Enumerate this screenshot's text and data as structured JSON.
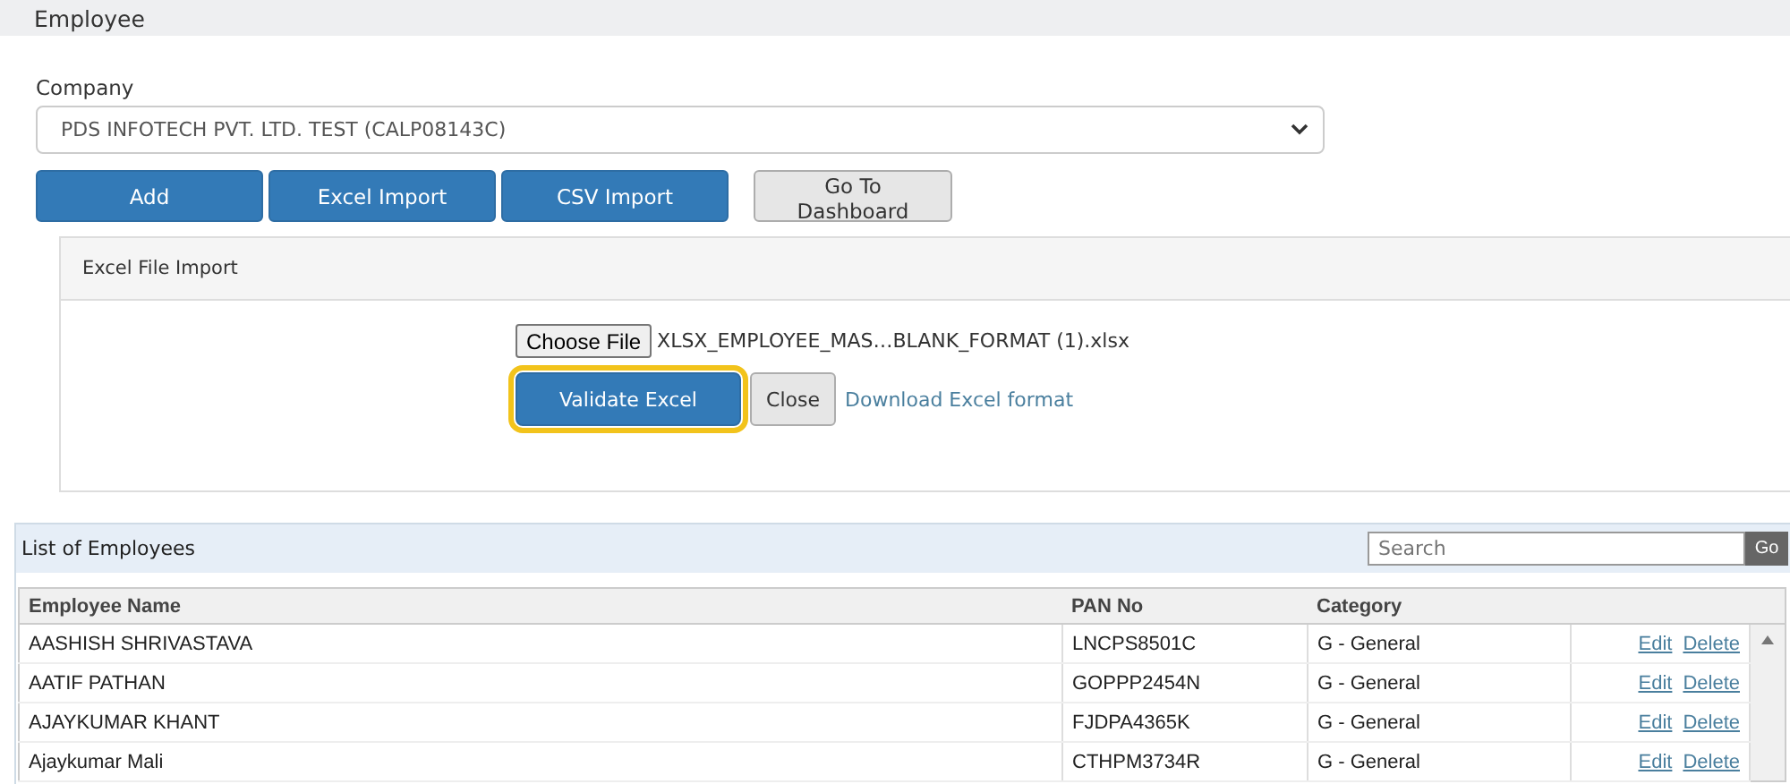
{
  "header": {
    "title": "Employee"
  },
  "company": {
    "label": "Company",
    "value": "PDS INFOTECH PVT. LTD. TEST (CALP08143C)"
  },
  "actions": [
    {
      "label": "Add",
      "kind": "primary"
    },
    {
      "label": "Excel Import",
      "kind": "primary"
    },
    {
      "label": "CSV Import",
      "kind": "primary"
    },
    {
      "label": "Go To Dashboard",
      "kind": "default"
    }
  ],
  "import_panel": {
    "title": "Excel File Import",
    "choose_button": "Choose File",
    "file_name": "XLSX_EMPLOYEE_MAS…BLANK_FORMAT (1).xlsx",
    "validate_button": {
      "label": "Validate Excel",
      "highlighted": true
    },
    "close_button": "Close",
    "download_link": "Download Excel format"
  },
  "employee_list": {
    "title": "List of Employees",
    "search": {
      "placeholder": "Search"
    },
    "go_button": "Go",
    "columns": [
      "Employee Name",
      "PAN No",
      "Category"
    ],
    "rows": [
      {
        "name": "AASHISH SHRIVASTAVA",
        "pan": "LNCPS8501C",
        "category": "G - General",
        "edit": "Edit",
        "delete": "Delete"
      },
      {
        "name": "AATIF PATHAN",
        "pan": "GOPPP2454N",
        "category": "G - General",
        "edit": "Edit",
        "delete": "Delete"
      },
      {
        "name": "AJAYKUMAR KHANT",
        "pan": "FJDPA4365K",
        "category": "G - General",
        "edit": "Edit",
        "delete": "Delete"
      },
      {
        "name": "Ajaykumar Mali",
        "pan": "CTHPM3734R",
        "category": "G - General",
        "edit": "Edit",
        "delete": "Delete"
      }
    ]
  }
}
